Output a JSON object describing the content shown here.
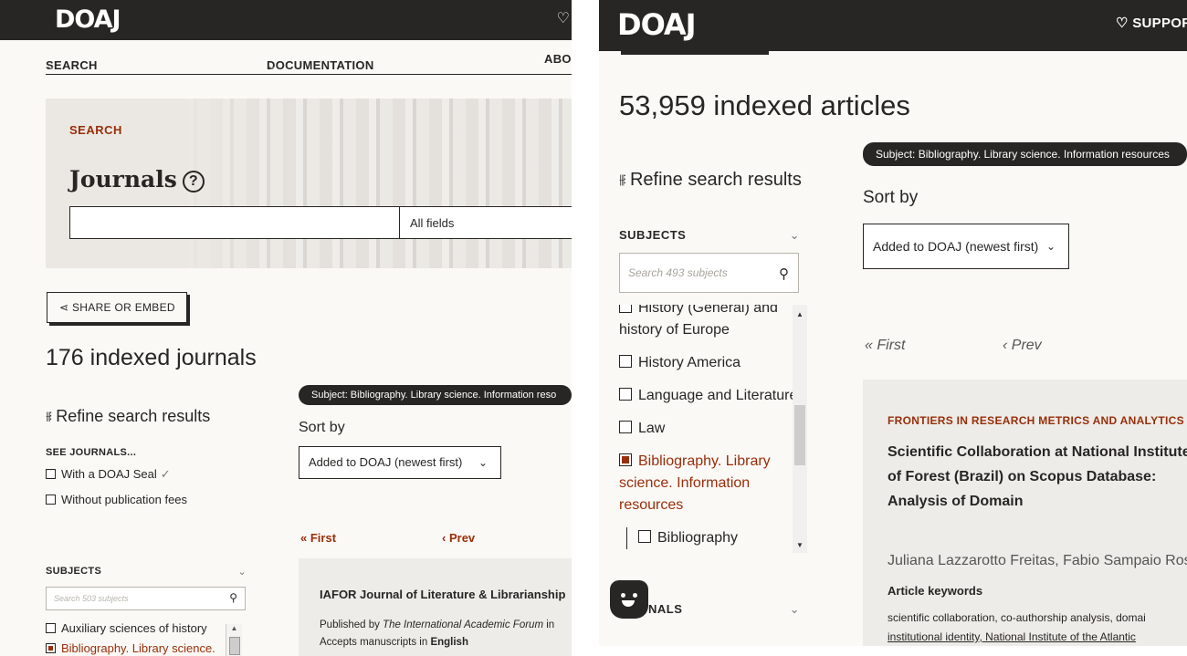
{
  "left": {
    "logo": "DOAJ",
    "nav": [
      {
        "label": "SEARCH",
        "chevron": "⌄"
      },
      {
        "label": "DOCUMENTATION",
        "chevron": "⌄"
      },
      {
        "label": "ABO"
      }
    ],
    "hero": {
      "label": "SEARCH",
      "title": "Journals",
      "help_symbol": "?",
      "field": "All fields"
    },
    "share_label": "SHARE OR EMBED",
    "count": "176 indexed journals",
    "refine": "Refine search results",
    "see_journals": "SEE JOURNALS...",
    "filters": [
      {
        "label": "With a DOAJ Seal",
        "checked": false
      },
      {
        "label": "Without publication fees",
        "checked": false
      }
    ],
    "subjects_heading": "SUBJECTS",
    "subjects_placeholder": "Search 503 subjects",
    "subjects": [
      {
        "label": "Auxiliary sciences of history",
        "checked": false
      },
      {
        "label": "Bibliography. Library science. Information resources",
        "checked": true
      }
    ],
    "filter_pill": "Subject: Bibliography. Library science. Information reso",
    "sort_by": "Sort by",
    "sort_value": "Added to DOAJ (newest first)",
    "first": "First",
    "prev": "Prev",
    "result": {
      "title": "IAFOR Journal of Literature & Librarianship",
      "published_prefix": "Published by ",
      "publisher": "The International Academic Forum",
      "published_suffix": " in",
      "accepts_prefix": "Accepts manuscripts in ",
      "language": "English"
    }
  },
  "right": {
    "logo": "DOAJ",
    "support": "SUPPOR",
    "count": "53,959 indexed articles",
    "refine": "Refine search results",
    "filter_pill": "Subject: Bibliography. Library science. Information resources",
    "sort_by": "Sort by",
    "sort_value": "Added to DOAJ (newest first)",
    "subjects_heading": "SUBJECTS",
    "subjects_placeholder": "Search 493 subjects",
    "subjects": [
      {
        "label": "History (General) and history of Europe",
        "checked": false
      },
      {
        "label": "History America",
        "checked": false
      },
      {
        "label": "Language and Literature",
        "checked": false
      },
      {
        "label": "Law",
        "checked": false
      },
      {
        "label": "Bibliography. Library science. Information resources",
        "checked": true
      }
    ],
    "sub_subject": "Bibliography",
    "journals_heading": "NALS",
    "first": "First",
    "prev": "Prev",
    "article": {
      "journal": "FRONTIERS IN RESEARCH METRICS AND ANALYTICS (D",
      "title": "Scientific Collaboration at National Institute of Forest (Brazil) on Scopus Database: Analysis of Domain",
      "authors": "Juliana Lazzarotto Freitas, Fabio Sampaio Rosas",
      "keywords_heading": "Article keywords",
      "keywords_1": "scientific collaboration, co-authorship analysis, domai",
      "keywords_2": "institutional identity, National Institute of the Atlantic"
    }
  },
  "colors": {
    "brand_dark": "#282624",
    "accent": "#982e0a",
    "background": "#fbf9f6",
    "card": "#eeece8"
  }
}
